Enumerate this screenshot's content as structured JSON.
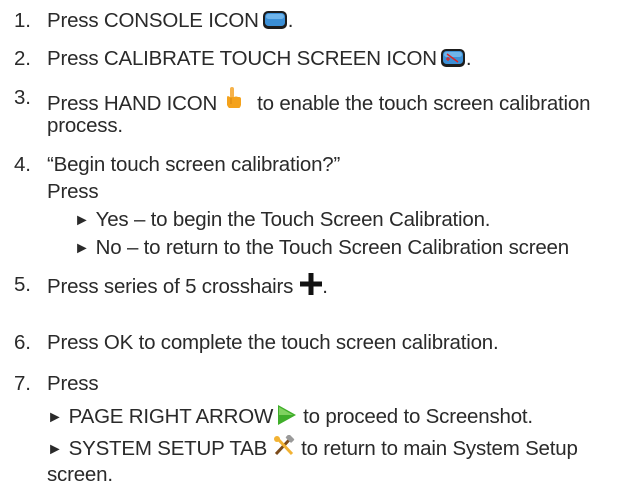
{
  "steps": [
    {
      "num": "1.",
      "text": "Press CONSOLE ICON",
      "tail": "."
    },
    {
      "num": "2.",
      "text": "Press CALIBRATE TOUCH SCREEN ICON",
      "tail": "."
    },
    {
      "num": "3.",
      "text": "Press HAND ICON",
      "tail": "to enable the touch screen calibration",
      "cont": "process."
    },
    {
      "num": "4.",
      "text": "“Begin touch screen calibration?”",
      "press": "Press",
      "options": [
        "Yes – to begin the Touch Screen Calibration.",
        "No – to return to the Touch Screen Calibration screen"
      ]
    },
    {
      "num": "5.",
      "text": "Press series of 5 crosshairs",
      "tail": "."
    },
    {
      "num": "6.",
      "text": "Press OK to complete the touch screen calibration."
    },
    {
      "num": "7.",
      "text": "Press",
      "opt1_a": "PAGE RIGHT ARROW",
      "opt1_b": "to proceed to Screenshot.",
      "opt2_a": "SYSTEM SETUP TAB",
      "opt2_b": "to return to main System Setup",
      "opt2_cont": "screen."
    }
  ],
  "bullet": "►",
  "icons": [
    "console-icon",
    "calibrate-touch-screen-icon",
    "hand-icon",
    "crosshair-icon",
    "page-right-arrow-icon",
    "system-setup-tab-icon"
  ],
  "colors": {
    "text": "#2a2a2a",
    "console_icon": "#3b8fd6",
    "arrow": "#3fae2a",
    "hand": "#f4a21c"
  }
}
